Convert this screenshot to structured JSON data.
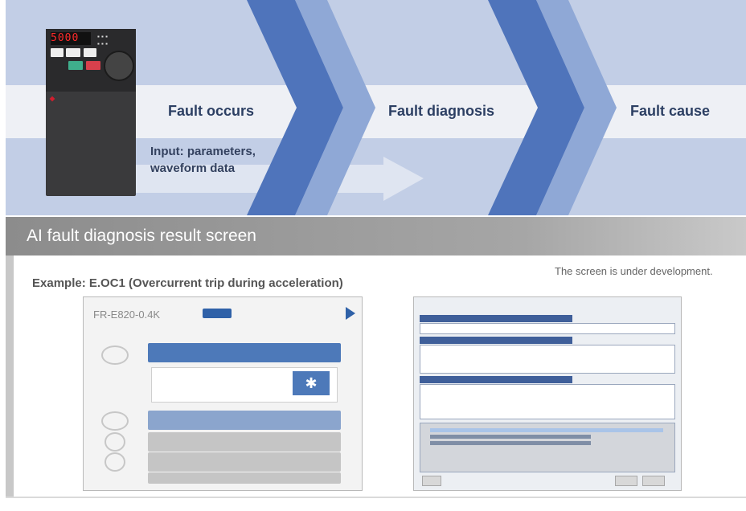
{
  "flow": {
    "steps": [
      {
        "label": "Fault occurs"
      },
      {
        "label": "Fault diagnosis"
      },
      {
        "label": "Fault cause"
      }
    ],
    "input_line1": "Input: parameters,",
    "input_line2": "waveform data"
  },
  "device": {
    "display_value": "5000"
  },
  "section": {
    "title": "AI fault diagnosis result screen"
  },
  "example": {
    "label": "Example: E.OC1 (Overcurrent trip during acceleration)",
    "note": "The screen is under development."
  },
  "screen1": {
    "model": "FR-E820-0.4K"
  },
  "colors": {
    "band": "#c2cee6",
    "chevron_dark": "#4f74bb",
    "chevron_light": "#8fa8d6",
    "section_header": "#9a9a9a",
    "step_text": "#2c3f63"
  }
}
